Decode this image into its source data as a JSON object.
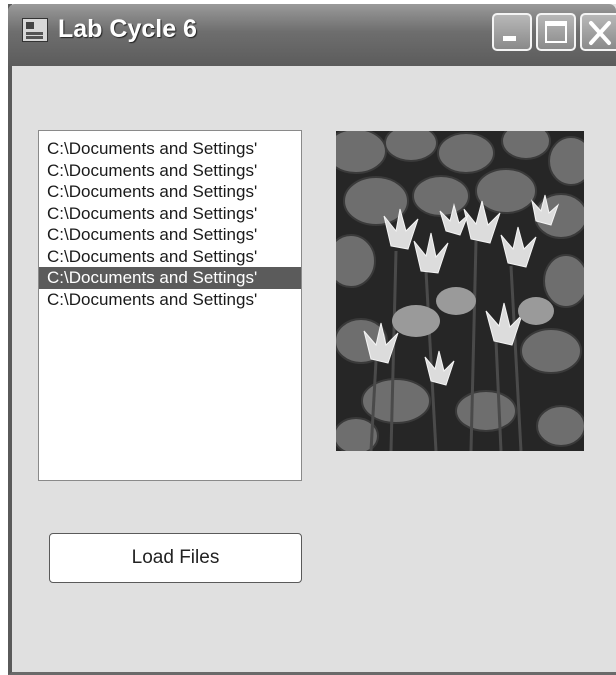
{
  "window": {
    "title": "Lab Cycle 6"
  },
  "titlebar": {
    "icon": "app-form-icon"
  },
  "caption_buttons": {
    "minimize": "minimize-icon",
    "maximize": "maximize-icon",
    "close": "close-icon"
  },
  "file_list": {
    "items": [
      "C:\\Documents and Settings'",
      "C:\\Documents and Settings'",
      "C:\\Documents and Settings'",
      "C:\\Documents and Settings'",
      "C:\\Documents and Settings'",
      "C:\\Documents and Settings'",
      "C:\\Documents and Settings'",
      "C:\\Documents and Settings'"
    ],
    "selected_index": 6
  },
  "picture_box": {
    "content": "water-lily-photo"
  },
  "load_button": {
    "label": "Load Files"
  }
}
